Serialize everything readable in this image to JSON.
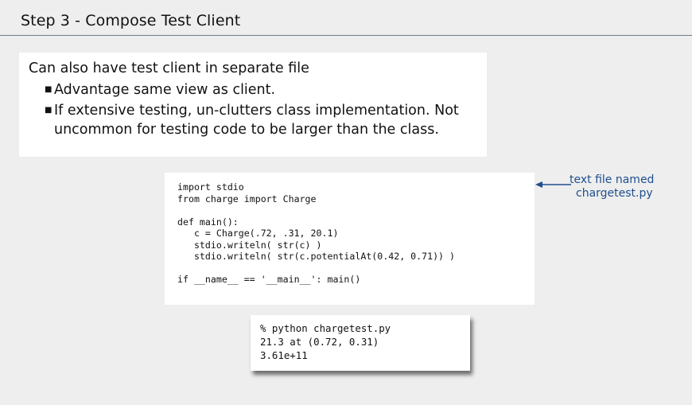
{
  "slide": {
    "title": "Step 3 - Compose Test Client"
  },
  "summary": {
    "intro": "Can also have test client in separate file",
    "bullets": [
      "Advantage same view as client.",
      "If extensive testing, un-clutters class implementation.  Not uncommon for testing code to be larger than the class."
    ]
  },
  "code_listing": {
    "lines": [
      "import stdio",
      "from charge import Charge",
      "",
      "def main():",
      "   c = Charge(.72, .31, 20.1)",
      "   stdio.writeln( str(c) )",
      "   stdio.writeln( str(c.potentialAt(0.42, 0.71)) )",
      "",
      "if __name__ == '__main__': main()"
    ]
  },
  "annotation": {
    "line1": "text file named",
    "line2": "chargetest.py",
    "color": "#1f4f8c",
    "icon": "left-arrow-icon"
  },
  "terminal": {
    "lines": [
      "% python chargetest.py",
      "21.3 at (0.72, 0.31)",
      "3.61e+11"
    ]
  }
}
